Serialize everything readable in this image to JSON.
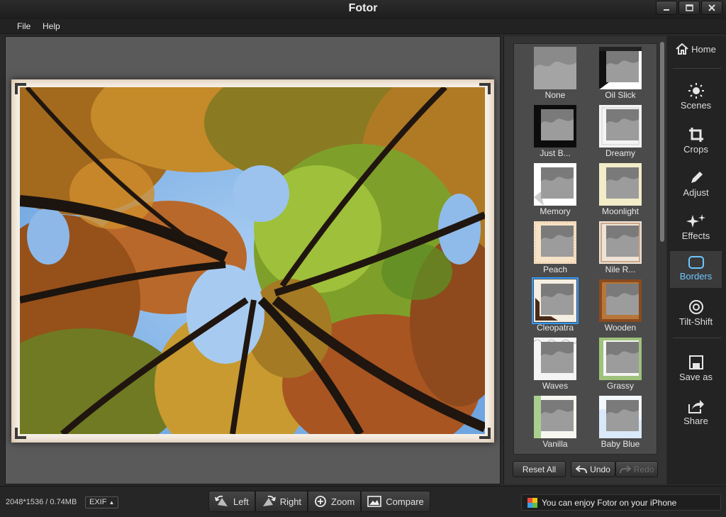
{
  "app": {
    "title": "Fotor"
  },
  "menu": {
    "file": "File",
    "help": "Help"
  },
  "borders": [
    {
      "label": "None",
      "style": "none"
    },
    {
      "label": "Oil Slick",
      "style": "oil"
    },
    {
      "label": "Just B...",
      "style": "black"
    },
    {
      "label": "Dreamy",
      "style": "dreamy"
    },
    {
      "label": "Memory",
      "style": "memory"
    },
    {
      "label": "Moonlight",
      "style": "moon"
    },
    {
      "label": "Peach",
      "style": "peach"
    },
    {
      "label": "Nile R...",
      "style": "nile"
    },
    {
      "label": "Cleopatra",
      "style": "cleo",
      "selected": true
    },
    {
      "label": "Wooden",
      "style": "wood"
    },
    {
      "label": "Waves",
      "style": "waves"
    },
    {
      "label": "Grassy",
      "style": "grassy"
    },
    {
      "label": "Vanilla",
      "style": "vanilla"
    },
    {
      "label": "Baby Blue",
      "style": "baby"
    }
  ],
  "panel": {
    "reset_all": "Reset All",
    "undo": "Undo",
    "redo": "Redo"
  },
  "nav": {
    "home": "Home",
    "scenes": "Scenes",
    "crops": "Crops",
    "adjust": "Adjust",
    "effects": "Effects",
    "borders": "Borders",
    "tilt_shift": "Tilt-Shift",
    "save_as": "Save as",
    "share": "Share"
  },
  "status": {
    "dimensions": "2048*1536 / 0.74MB",
    "exif": "EXIF",
    "tools": {
      "left": "Left",
      "right": "Right",
      "zoom": "Zoom",
      "compare": "Compare"
    },
    "promo": "You can enjoy Fotor on your iPhone"
  },
  "colors": {
    "accent": "#6ec6ff",
    "selected_border": "#2f9bff"
  },
  "icons": [
    "home-icon",
    "sun-icon",
    "crop-icon",
    "pencil-icon",
    "sparkle-icon",
    "rounded-rect-icon",
    "target-icon",
    "save-icon",
    "share-icon"
  ]
}
